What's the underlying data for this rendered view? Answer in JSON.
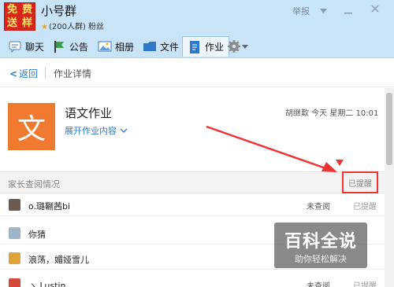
{
  "window": {
    "group_name": "小号群",
    "group_meta": "(200人群) 粉丝",
    "report_label": "举报",
    "avatar_chars": [
      "免",
      "费",
      "送",
      "样"
    ]
  },
  "toolbar": {
    "tabs": [
      {
        "label": "聊天",
        "icon": "chat-icon"
      },
      {
        "label": "公告",
        "icon": "flag-icon"
      },
      {
        "label": "相册",
        "icon": "album-icon"
      },
      {
        "label": "文件",
        "icon": "folder-icon"
      },
      {
        "label": "作业",
        "icon": "homework-icon",
        "active": true
      }
    ],
    "settings_icon": "gear-icon"
  },
  "nav": {
    "back_label": "返回",
    "title": "作业详情"
  },
  "homework": {
    "icon_char": "文",
    "title": "语文作业",
    "expand_label": "展开作业内容",
    "author_time": "胡继歎 今天 星期二 10:01"
  },
  "section": {
    "title": "家长查阅情况",
    "status": "已提醒"
  },
  "rows": [
    {
      "name": "o.璐鞩茜bi",
      "status": "未查阅",
      "remind": "已提醒",
      "avatar_color": "#6b5a4e"
    },
    {
      "name": "你猜",
      "status": "",
      "remind": "",
      "avatar_color": "#9fb4c8"
    },
    {
      "name": "浪荡，媚娅雪儿",
      "status": "",
      "remind": "",
      "avatar_color": "#e0a23a"
    },
    {
      "name": "ゝ Lustin",
      "status": "未查阅",
      "remind": "已提醒",
      "avatar_color": "#d44a3a"
    }
  ],
  "watermark": {
    "main": "百科全说",
    "sub": "助你轻松解决"
  },
  "colors": {
    "accent_blue": "#2b7ad0",
    "homework_orange": "#f07a2f",
    "highlight_red": "#e33333",
    "titlebar_bg": "#c9e4f6"
  }
}
